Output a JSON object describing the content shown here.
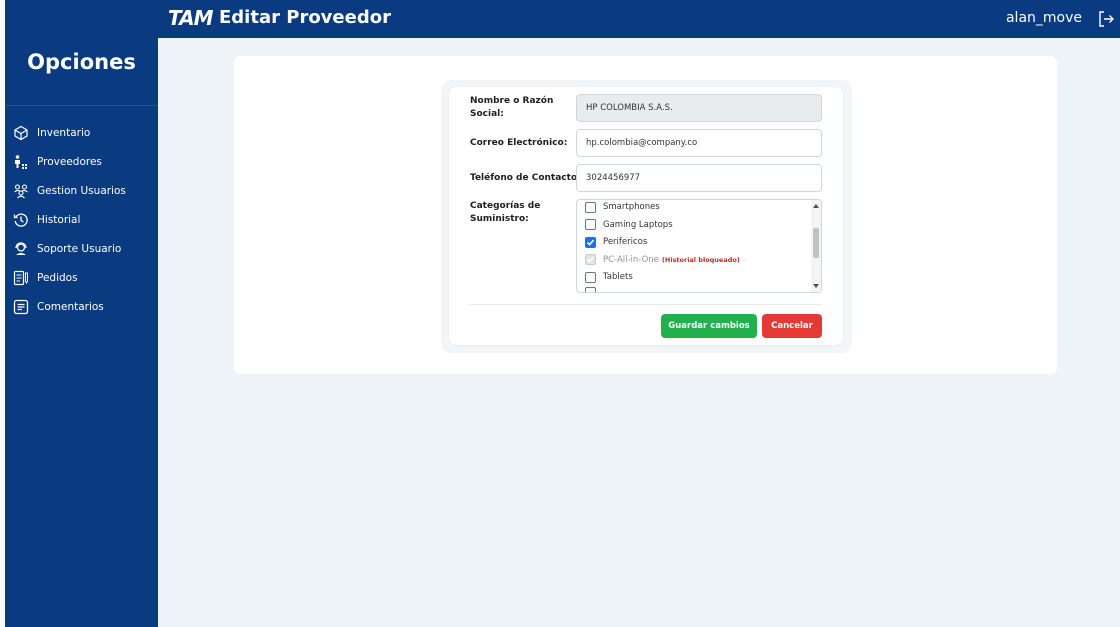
{
  "header": {
    "logo": "TAM",
    "title": "Editar Proveedor",
    "username": "alan_move"
  },
  "sidebar": {
    "title": "Opciones",
    "items": [
      {
        "label": "Inventario",
        "icon": "cube-icon"
      },
      {
        "label": "Proveedores",
        "icon": "suppliers-icon"
      },
      {
        "label": "Gestion Usuarios",
        "icon": "users-icon"
      },
      {
        "label": "Historial",
        "icon": "history-icon"
      },
      {
        "label": "Soporte Usuario",
        "icon": "support-icon"
      },
      {
        "label": "Pedidos",
        "icon": "orders-icon"
      },
      {
        "label": "Comentarios",
        "icon": "comments-icon"
      }
    ]
  },
  "form": {
    "name_label": "Nombre o Razón Social:",
    "name_value": "HP COLOMBIA S.A.S.",
    "email_label": "Correo Electrónico:",
    "email_value": "hp.colombia@company.co",
    "phone_label": "Teléfono de Contacto:",
    "phone_value": "3024456977",
    "categories_label": "Categorías de Suministro:",
    "categories": [
      {
        "label": "Smartphones",
        "checked": false,
        "disabled": false
      },
      {
        "label": "Gaming Laptops",
        "checked": false,
        "disabled": false
      },
      {
        "label": "Perifericos",
        "checked": true,
        "disabled": false
      },
      {
        "label": "PC-All-in-One",
        "checked": true,
        "disabled": true,
        "note": "(Historial bloqueado)"
      },
      {
        "label": "Tablets",
        "checked": false,
        "disabled": false
      }
    ],
    "save_label": "Guardar cambios",
    "cancel_label": "Cancelar"
  },
  "colors": {
    "navy": "#0a3a80",
    "save": "#21b04b",
    "cancel": "#e53935",
    "checkbox": "#1a73e8"
  }
}
